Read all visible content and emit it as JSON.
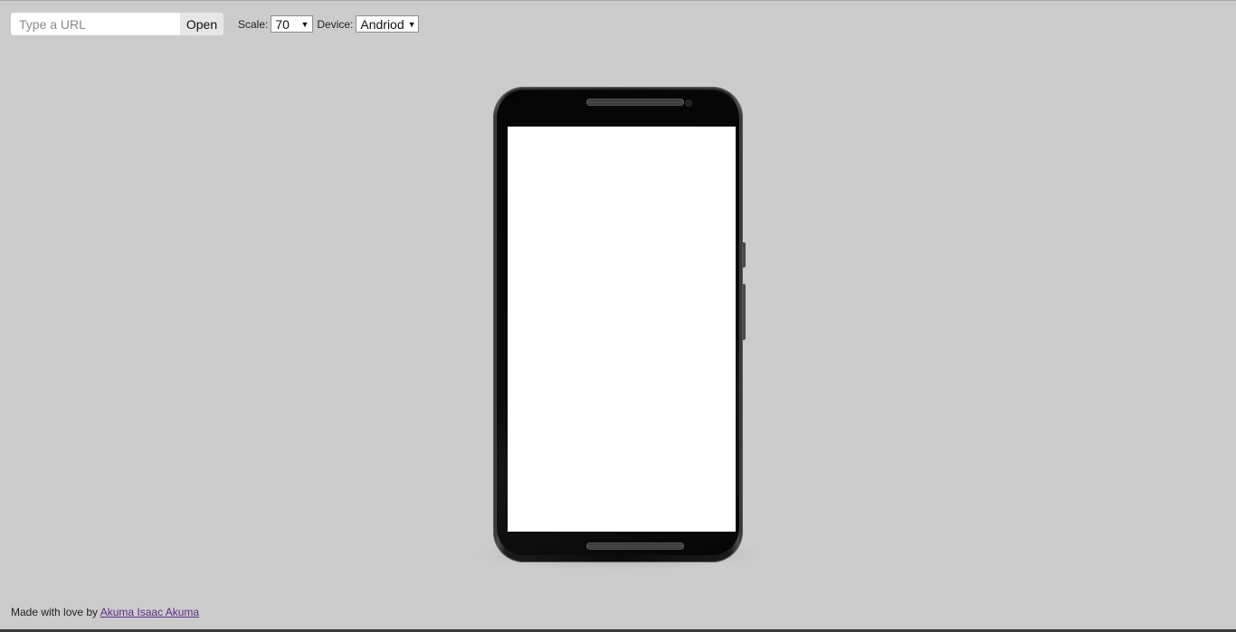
{
  "url_bar": {
    "placeholder": "Type a URL",
    "value": "",
    "open_label": "Open"
  },
  "controls": {
    "scale_label": "Scale:",
    "scale_value": "70",
    "device_label": "Device:",
    "device_value": "Andriod"
  },
  "device_preview": {
    "frame_color": "#0b0b0b",
    "screen_color": "#ffffff"
  },
  "footer": {
    "text": "Made with love by",
    "author_link": "Akuma Isaac Akuma"
  },
  "icons": {
    "dropdown": "caret-down-icon"
  }
}
